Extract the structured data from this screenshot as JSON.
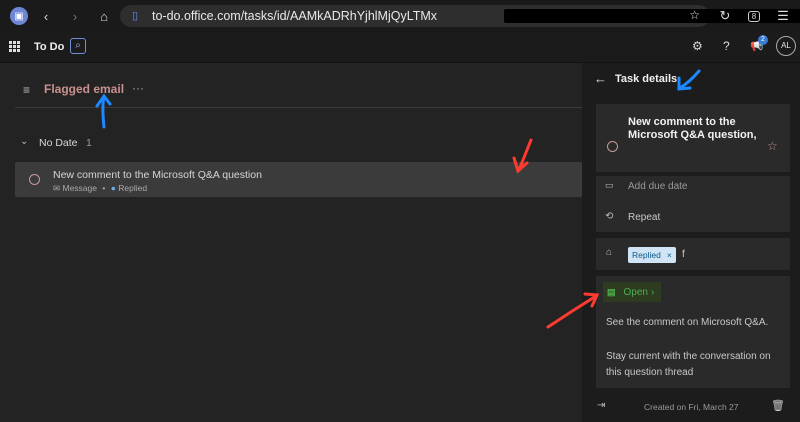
{
  "browser": {
    "url": "to-do.office.com/tasks/id/AAMkADRhYjhlMjQyLTMx",
    "tab_count": "8"
  },
  "app": {
    "name": "To Do",
    "avatar_initials": "AL",
    "notification_count": "2"
  },
  "list": {
    "title": "Flagged email",
    "more_label": "···",
    "group_title": "No Date",
    "group_count": "1",
    "tasks": [
      {
        "title": "New comment to the Microsoft Q&A question",
        "type": "Message",
        "separator": "•",
        "category": "Replied"
      }
    ]
  },
  "details": {
    "header": "Task details",
    "task_title": "New comment to the Microsoft Q&A question,",
    "add_due_date": "Add due date",
    "repeat": "Repeat",
    "category": "Replied",
    "category_suffix": "f",
    "open_label": "Open",
    "note_line1": "See the comment on Microsoft Q&A.",
    "note_line2": "Stay current with the conversation on this question thread",
    "created": "Created on Fri, March 27"
  },
  "colors": {
    "accent_list": "#c9918f",
    "open_green": "#4caf50",
    "annotation_blue": "#1e88ff",
    "annotation_red": "#ff3b30"
  }
}
